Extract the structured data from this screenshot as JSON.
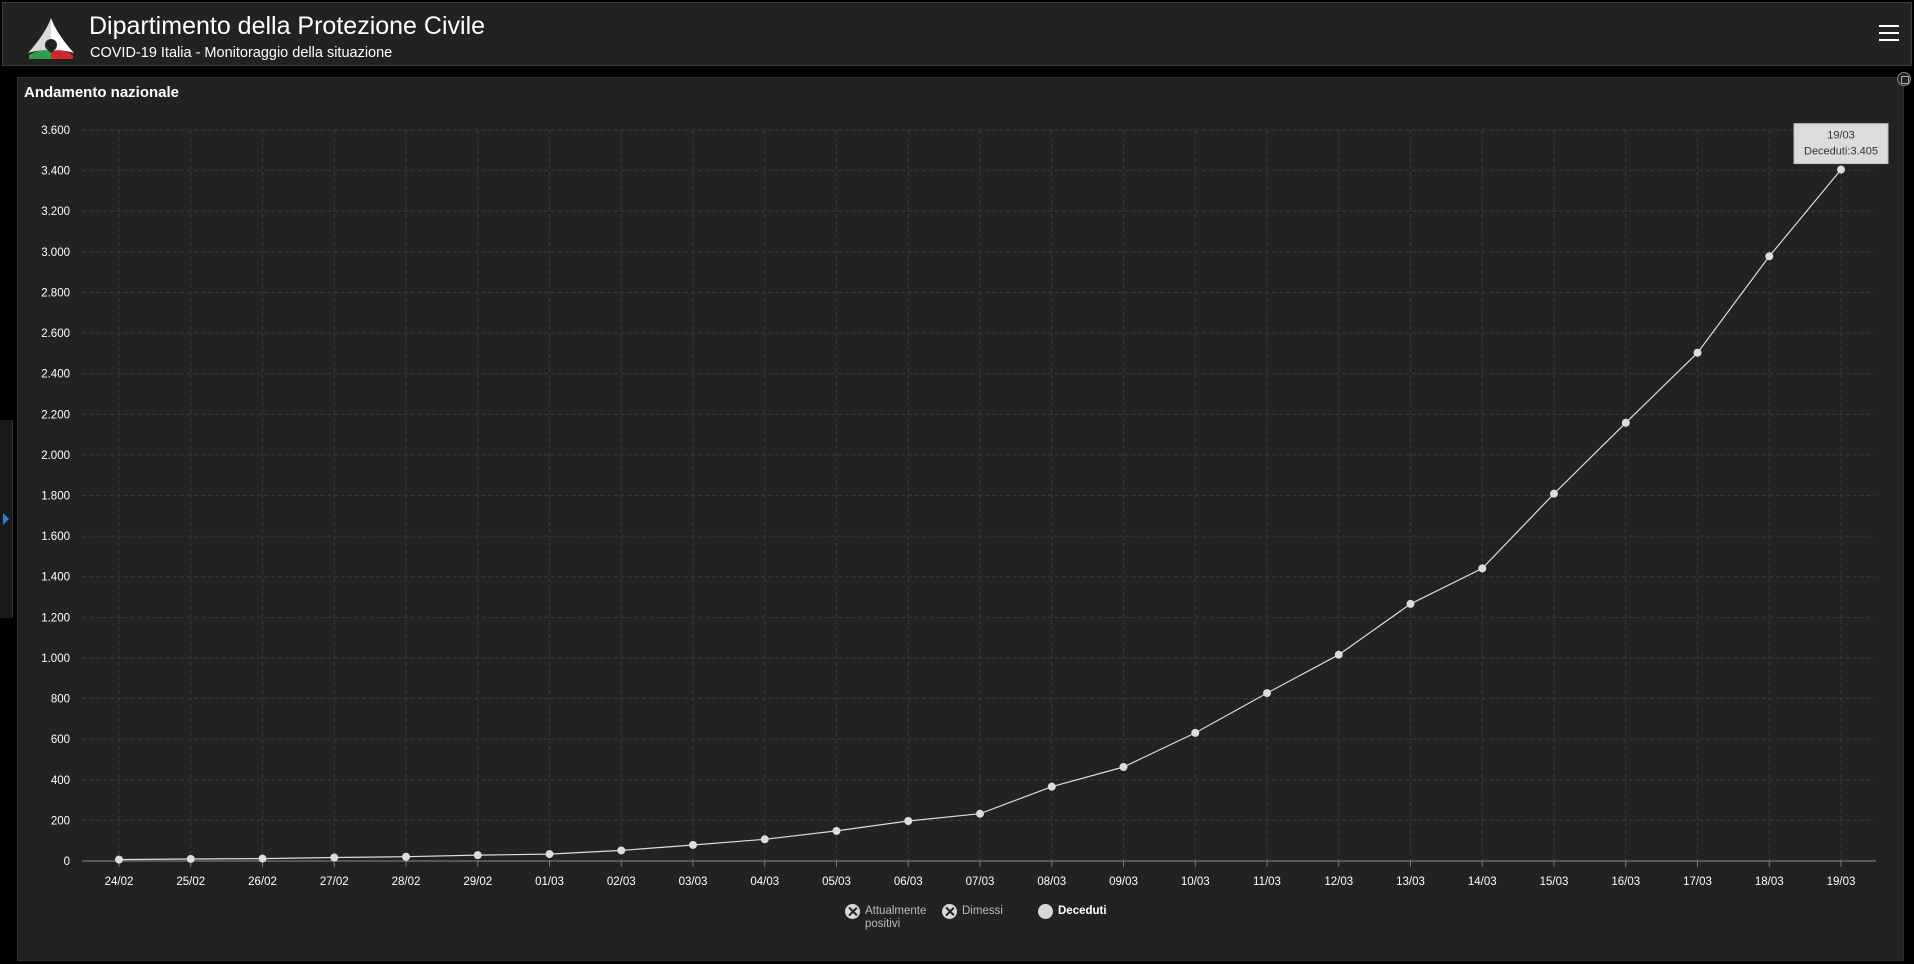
{
  "header": {
    "title": "Dipartimento della Protezione Civile",
    "subtitle": "COVID-19 Italia - Monitoraggio della situazione"
  },
  "panel": {
    "title": "Andamento nazionale"
  },
  "legend": [
    {
      "label_line1": "Attualmente",
      "label_line2": "positivi",
      "active": false
    },
    {
      "label_line1": "Dimessi",
      "label_line2": "",
      "active": false
    },
    {
      "label_line1": "Deceduti",
      "label_line2": "",
      "active": true
    }
  ],
  "tooltip": {
    "date": "19/03",
    "text": "Deceduti:3.405"
  },
  "colors": {
    "background": "#222222",
    "series": "#dddddd",
    "grid": "#3a3a3a"
  },
  "icons": {
    "logo": "protezione-civile-logo",
    "menu": "hamburger-menu-icon",
    "expand": "expand-icon"
  },
  "chart_data": {
    "type": "line",
    "categories": [
      "24/02",
      "25/02",
      "26/02",
      "27/02",
      "28/02",
      "29/02",
      "01/03",
      "02/03",
      "03/03",
      "04/03",
      "05/03",
      "06/03",
      "07/03",
      "08/03",
      "09/03",
      "10/03",
      "11/03",
      "12/03",
      "13/03",
      "14/03",
      "15/03",
      "16/03",
      "17/03",
      "18/03",
      "19/03"
    ],
    "series": [
      {
        "name": "Deceduti",
        "values": [
          7,
          10,
          12,
          17,
          21,
          29,
          34,
          52,
          79,
          107,
          148,
          197,
          233,
          366,
          463,
          631,
          827,
          1016,
          1266,
          1441,
          1809,
          2158,
          2503,
          2978,
          3405
        ]
      }
    ],
    "y_ticks": [
      "0",
      "200",
      "400",
      "600",
      "800",
      "1.000",
      "1.200",
      "1.400",
      "1.600",
      "1.800",
      "2.000",
      "2.200",
      "2.400",
      "2.600",
      "2.800",
      "3.000",
      "3.200",
      "3.400",
      "3.600"
    ],
    "ylim": [
      0,
      3600
    ],
    "grid": true,
    "legend_position": "bottom"
  }
}
